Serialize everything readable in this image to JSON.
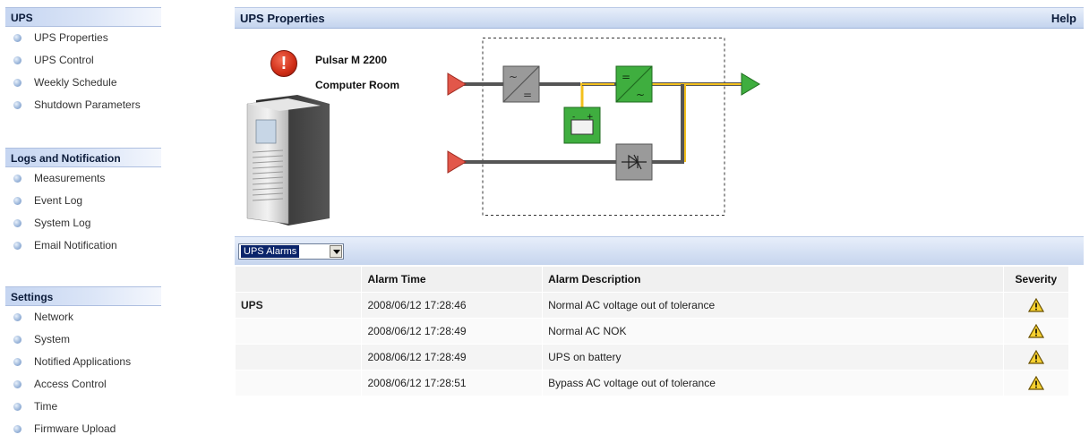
{
  "sidebar": {
    "sections": [
      {
        "title": "UPS",
        "items": [
          "UPS Properties",
          "UPS Control",
          "Weekly Schedule",
          "Shutdown Parameters"
        ]
      },
      {
        "title": "Logs and Notification",
        "items": [
          "Measurements",
          "Event Log",
          "System Log",
          "Email Notification"
        ]
      },
      {
        "title": "Settings",
        "items": [
          "Network",
          "System",
          "Notified Applications",
          "Access Control",
          "Time",
          "Firmware Upload"
        ]
      }
    ]
  },
  "header": {
    "title": "UPS Properties",
    "help": "Help"
  },
  "ups": {
    "model": "Pulsar M 2200",
    "location": "Computer Room",
    "status_icon": "alarm-exclamation-icon"
  },
  "alarms": {
    "selector": "UPS Alarms",
    "columns": [
      "",
      "Alarm Time",
      "Alarm Description",
      "Severity"
    ],
    "rows": [
      {
        "source": "UPS",
        "time": "2008/06/12 17:28:46",
        "description": "Normal AC voltage out of tolerance",
        "severity": "warning"
      },
      {
        "source": "",
        "time": "2008/06/12 17:28:49",
        "description": "Normal AC NOK",
        "severity": "warning"
      },
      {
        "source": "",
        "time": "2008/06/12 17:28:49",
        "description": "UPS on battery",
        "severity": "warning"
      },
      {
        "source": "",
        "time": "2008/06/12 17:28:51",
        "description": "Bypass AC voltage out of tolerance",
        "severity": "warning"
      }
    ]
  },
  "colors": {
    "accent": "#c6d5ee",
    "active_path": "#f3c01d",
    "module_ok": "#3fae3f",
    "module_off": "#9a9a9a"
  }
}
